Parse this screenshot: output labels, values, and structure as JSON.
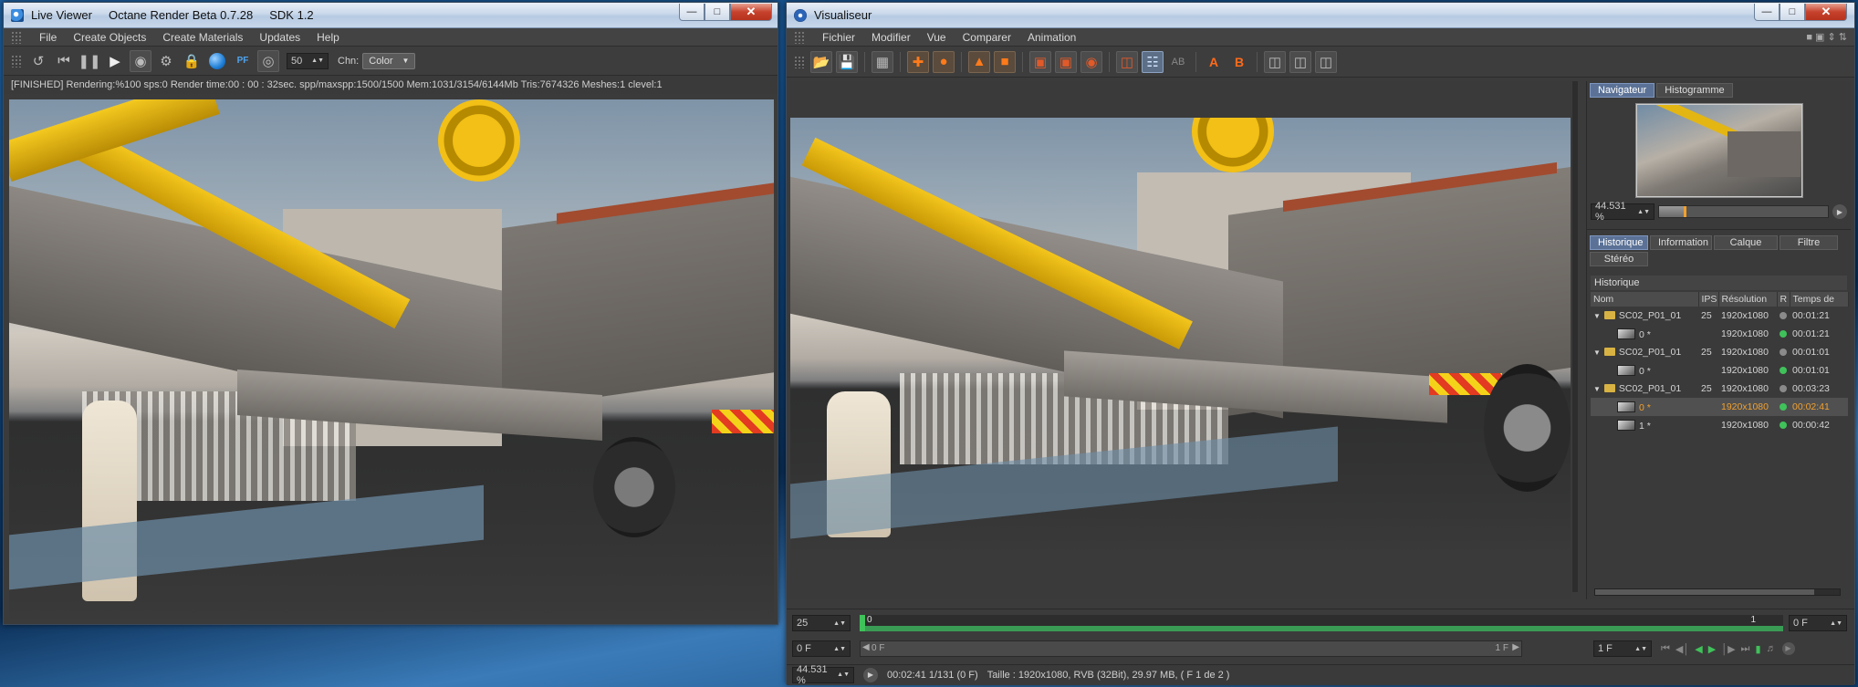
{
  "live_viewer": {
    "title": "Live Viewer",
    "app": "Octane Render Beta 0.7.28",
    "sdk": "SDK 1.2",
    "menu": [
      "File",
      "Create Objects",
      "Create Materials",
      "Updates",
      "Help"
    ],
    "toolbar": {
      "icons": [
        "reset-camera-icon",
        "skip-back-icon",
        "pause-icon",
        "play-icon",
        "eye-icon",
        "settings-icon",
        "lock-icon",
        "sphere-icon",
        "pf-icon",
        "pick-focus-icon"
      ],
      "pf_label": "PF",
      "samples_value": "50",
      "channel_label": "Chn:",
      "channel_value": "Color"
    },
    "status": "[FINISHED]  Rendering:%100 sps:0 Render time:00 : 00 : 32sec. spp/maxspp:1500/1500 Mem:1031/3154/6144Mb Tris:7674326 Meshes:1 clevel:1"
  },
  "visualiseur": {
    "title": "Visualiseur",
    "menu": [
      "Fichier",
      "Modifier",
      "Vue",
      "Comparer",
      "Animation"
    ],
    "toolbar": {
      "icons": [
        "open-icon",
        "save-icon",
        "grid-icon",
        "render-region-icon",
        "render-active-icon",
        "export-icon",
        "stop-icon",
        "view-a-icon",
        "view-b-icon",
        "view-c-icon",
        "compare-icon",
        "split-icon",
        "ab-text-icon",
        "set-a-icon",
        "set-b-icon",
        "layout-1-icon",
        "layout-2-icon",
        "layout-3-icon"
      ],
      "ab_text": "AB",
      "a_label": "A",
      "b_label": "B"
    },
    "navigator": {
      "tabs": [
        "Navigateur",
        "Histogramme"
      ],
      "active_tab": 0,
      "zoom_value": "44.531 %"
    },
    "history": {
      "tabs": [
        "Historique",
        "Information",
        "Calque",
        "Filtre",
        "Stéréo"
      ],
      "active_tab": 0,
      "section_title": "Historique",
      "columns": [
        "Nom",
        "IPS",
        "Résolution",
        "R",
        "Temps de"
      ],
      "rows": [
        {
          "kind": "group",
          "name": "SC02_P01_01",
          "ips": "25",
          "res": "1920x1080",
          "dot": "#8a8a8a",
          "time": "00:01:21",
          "selected": false
        },
        {
          "kind": "item",
          "name": "0 *",
          "ips": "",
          "res": "1920x1080",
          "dot": "#3fc25a",
          "time": "00:01:21",
          "selected": false
        },
        {
          "kind": "group",
          "name": "SC02_P01_01",
          "ips": "25",
          "res": "1920x1080",
          "dot": "#8a8a8a",
          "time": "00:01:01",
          "selected": false
        },
        {
          "kind": "item",
          "name": "0 *",
          "ips": "",
          "res": "1920x1080",
          "dot": "#3fc25a",
          "time": "00:01:01",
          "selected": false
        },
        {
          "kind": "group",
          "name": "SC02_P01_01",
          "ips": "25",
          "res": "1920x1080",
          "dot": "#8a8a8a",
          "time": "00:03:23",
          "selected": false
        },
        {
          "kind": "item",
          "name": "0 *",
          "ips": "",
          "res": "1920x1080",
          "dot": "#3fc25a",
          "time": "00:02:41",
          "selected": true
        },
        {
          "kind": "item",
          "name": "1 *",
          "ips": "",
          "res": "1920x1080",
          "dot": "#3fc25a",
          "time": "00:00:42",
          "selected": false
        }
      ]
    },
    "timeline": {
      "fps_value": "25",
      "start_marker": "0",
      "end_marker": "1",
      "end_frame_value": "0 F",
      "current_frame_value": "0 F",
      "range_start": "0 F",
      "range_end": "1 F",
      "step_value": "1 F"
    },
    "status": {
      "zoom": "44.531 %",
      "time_info": "00:02:41 1/131 (0 F)",
      "size_info": "Taille : 1920x1080, RVB (32Bit), 29.97 MB,  ( F 1 de 2 )"
    }
  }
}
